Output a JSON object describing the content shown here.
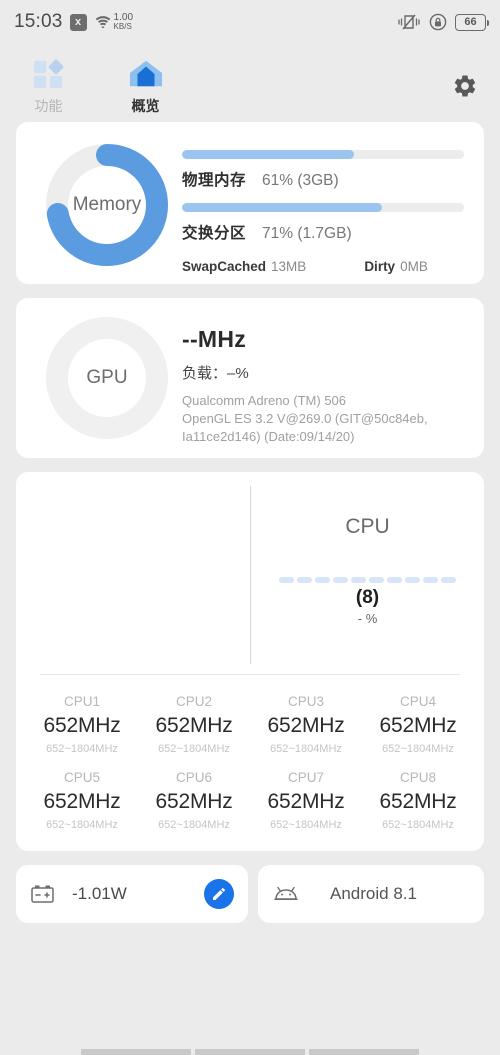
{
  "statusbar": {
    "time": "15:03",
    "x_badge": "x",
    "net_speed_value": "1.00",
    "net_speed_unit": "KB/S",
    "icons": [
      "vibrate-off-icon",
      "rotation-lock-icon"
    ],
    "battery_level": "66"
  },
  "tabs": [
    {
      "label": "功能",
      "icon": "grid-squares-icon",
      "active": false
    },
    {
      "label": "概览",
      "icon": "house-overview-icon",
      "active": true
    }
  ],
  "settings_button": {
    "icon": "gear-icon"
  },
  "memory": {
    "ring_label": "Memory",
    "ring_percent": 72,
    "rows": [
      {
        "key": "物理内存",
        "value": "61% (3GB)",
        "percent": 61
      },
      {
        "key": "交换分区",
        "value": "71% (1.7GB)",
        "percent": 71
      }
    ],
    "extras": [
      {
        "key": "SwapCached",
        "value": "13MB"
      },
      {
        "key": "Dirty",
        "value": "0MB"
      }
    ]
  },
  "gpu": {
    "ring_label": "GPU",
    "frequency": "--MHz",
    "load": "负载：–%",
    "desc_line1": "Qualcomm Adreno (TM) 506",
    "desc_line2": "OpenGL ES 3.2 V@269.0 (GIT@50c84eb,",
    "desc_line3": "Ia11ce2d146) (Date:09/14/20)"
  },
  "cpu": {
    "title": "CPU",
    "pill_count": 10,
    "core_count_label": "(8)",
    "usage_label": "- %",
    "cores": [
      {
        "name": "CPU1",
        "freq": "652MHz",
        "range": "652~1804MHz"
      },
      {
        "name": "CPU2",
        "freq": "652MHz",
        "range": "652~1804MHz"
      },
      {
        "name": "CPU3",
        "freq": "652MHz",
        "range": "652~1804MHz"
      },
      {
        "name": "CPU4",
        "freq": "652MHz",
        "range": "652~1804MHz"
      },
      {
        "name": "CPU5",
        "freq": "652MHz",
        "range": "652~1804MHz"
      },
      {
        "name": "CPU6",
        "freq": "652MHz",
        "range": "652~1804MHz"
      },
      {
        "name": "CPU7",
        "freq": "652MHz",
        "range": "652~1804MHz"
      },
      {
        "name": "CPU8",
        "freq": "652MHz",
        "range": "652~1804MHz"
      }
    ]
  },
  "battery_card": {
    "icon": "battery-horizontal-icon",
    "value": "-1.01W",
    "edit_icon": "pencil-icon"
  },
  "os_card": {
    "icon": "android-robot-icon",
    "value": "Android 8.1"
  },
  "colors": {
    "accent_blue": "#5b9be0",
    "light_blue": "#9bc4f0",
    "pill_blue": "#d6e5f7",
    "fab_blue": "#1a73e8",
    "track_gray": "#ececec",
    "page_bg": "#ebebeb"
  }
}
